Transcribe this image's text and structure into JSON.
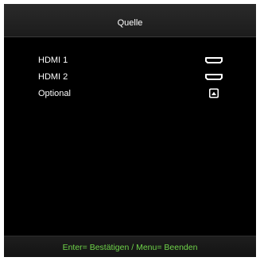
{
  "header": {
    "title": "Quelle"
  },
  "sources": [
    {
      "label": "HDMI 1",
      "icon": "hdmi-port-icon"
    },
    {
      "label": "HDMI 2",
      "icon": "hdmi-port-icon"
    },
    {
      "label": "Optional",
      "icon": "optional-source-icon"
    }
  ],
  "footer": {
    "hint": "Enter= Bestätigen / Menu= Beenden"
  },
  "colors": {
    "background": "#000000",
    "text": "#ffffff",
    "hint": "#6fd44a"
  }
}
